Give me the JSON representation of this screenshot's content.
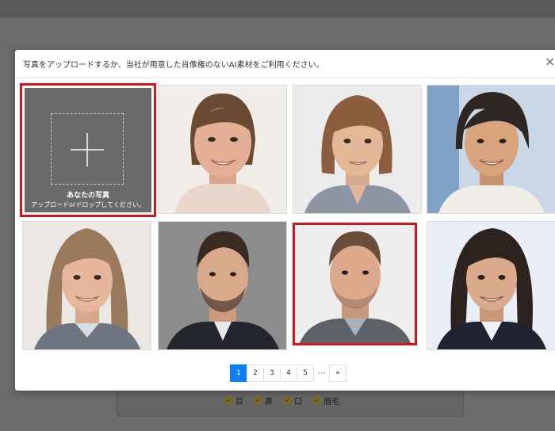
{
  "modal": {
    "title": "写真をアップロードするか、当社が用意した肖像権のないAI素材をご利用ください。",
    "close_label": "×"
  },
  "upload": {
    "label": "あなたの写真",
    "sublabel": "アップロードorドロップしてください。"
  },
  "photos": [
    {
      "id": "woman-1"
    },
    {
      "id": "woman-2"
    },
    {
      "id": "woman-3"
    },
    {
      "id": "girl-1"
    },
    {
      "id": "man-1"
    },
    {
      "id": "man-2",
      "selected": true
    },
    {
      "id": "woman-4"
    }
  ],
  "pagination": {
    "pages": [
      "1",
      "2",
      "3",
      "4",
      "5"
    ],
    "active": "1",
    "ellipsis": "⋯",
    "next": "»"
  },
  "background": {
    "checks": [
      "目",
      "鼻",
      "口",
      "眉毛"
    ]
  },
  "colors": {
    "accent": "#d0181c",
    "page_active": "#0d7ff5"
  }
}
